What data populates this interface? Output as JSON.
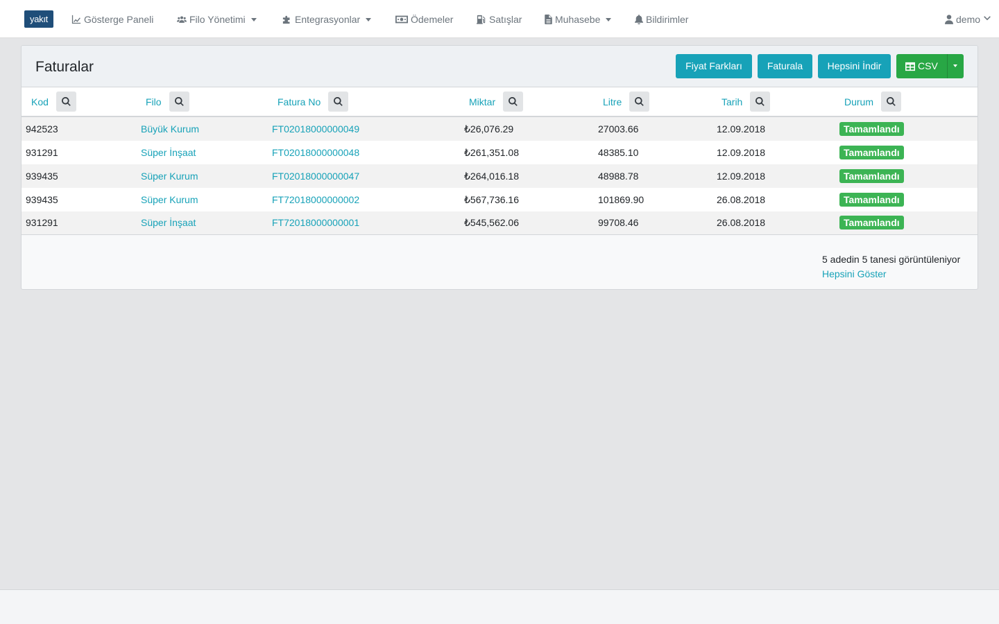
{
  "nav": {
    "brand": "yakıt",
    "items": [
      {
        "label": "Gösterge Paneli",
        "icon": "chart-line-icon",
        "dropdown": false
      },
      {
        "label": "Filo Yönetimi",
        "icon": "users-icon",
        "dropdown": true
      },
      {
        "label": "Entegrasyonlar",
        "icon": "puzzle-icon",
        "dropdown": true
      },
      {
        "label": "Ödemeler",
        "icon": "money-bill-icon",
        "dropdown": false
      },
      {
        "label": "Satışlar",
        "icon": "gas-pump-icon",
        "dropdown": false
      },
      {
        "label": "Muhasebe",
        "icon": "file-icon",
        "dropdown": true
      },
      {
        "label": "Bildirimler",
        "icon": "bell-icon",
        "dropdown": false
      }
    ],
    "user": "demo"
  },
  "card": {
    "title": "Faturalar",
    "buttons": {
      "price_diff": "Fiyat Farkları",
      "invoice": "Faturala",
      "download_all": "Hepsini İndir",
      "csv": "CSV"
    }
  },
  "table": {
    "columns": [
      "Kod",
      "Filo",
      "Fatura No",
      "Miktar",
      "Litre",
      "Tarih",
      "Durum"
    ],
    "rows": [
      {
        "kod": "942523",
        "filo": "Büyük Kurum",
        "fatura_no": "FT02018000000049",
        "miktar": "₺26,076.29",
        "litre": "27003.66",
        "tarih": "12.09.2018",
        "durum": "Tamamlandı"
      },
      {
        "kod": "931291",
        "filo": "Süper İnşaat",
        "fatura_no": "FT02018000000048",
        "miktar": "₺261,351.08",
        "litre": "48385.10",
        "tarih": "12.09.2018",
        "durum": "Tamamlandı"
      },
      {
        "kod": "939435",
        "filo": "Süper Kurum",
        "fatura_no": "FT02018000000047",
        "miktar": "₺264,016.18",
        "litre": "48988.78",
        "tarih": "12.09.2018",
        "durum": "Tamamlandı"
      },
      {
        "kod": "939435",
        "filo": "Süper Kurum",
        "fatura_no": "FT72018000000002",
        "miktar": "₺567,736.16",
        "litre": "101869.90",
        "tarih": "26.08.2018",
        "durum": "Tamamlandı"
      },
      {
        "kod": "931291",
        "filo": "Süper İnşaat",
        "fatura_no": "FT72018000000001",
        "miktar": "₺545,562.06",
        "litre": "99708.46",
        "tarih": "26.08.2018",
        "durum": "Tamamlandı"
      }
    ]
  },
  "pager": {
    "info": "5 adedin 5 tanesi görüntüleniyor",
    "show_all": "Hepsini Göster"
  },
  "colors": {
    "accent": "#17a2b8",
    "success": "#28a745",
    "badge": "#3cb454",
    "brand": "#1f4e79"
  }
}
